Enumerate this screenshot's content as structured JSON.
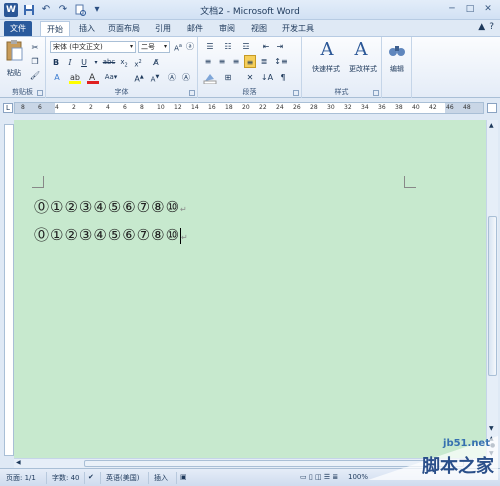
{
  "titlebar": {
    "logo": "W",
    "title": "文档2 - Microsoft Word",
    "qat": [
      "save-icon",
      "undo-icon",
      "redo-icon",
      "print-preview-icon",
      "customize-icon"
    ],
    "window_buttons": [
      "─",
      "□",
      "✕"
    ]
  },
  "tabs": {
    "file": "文件",
    "items": [
      "开始",
      "插入",
      "页面布局",
      "引用",
      "邮件",
      "审阅",
      "视图",
      "开发工具"
    ],
    "active": "开始",
    "right_icons": [
      "▲",
      "?"
    ]
  },
  "ribbon": {
    "clipboard": {
      "paste": "粘贴",
      "label": "剪贴板"
    },
    "font": {
      "name": "宋体 (中文正文)",
      "size": "二号",
      "label": "字体"
    },
    "paragraph": {
      "label": "段落"
    },
    "styles": {
      "quick": "快速样式",
      "change": "更改样式",
      "label": "样式"
    },
    "editing": {
      "label": "编辑"
    }
  },
  "document": {
    "line1": "⓪①②③④⑤⑥⑦⑧⑩",
    "line2": "⓪①②③④⑤⑥⑦⑧⑩",
    "para_mark": "↵"
  },
  "ruler": {
    "numbers": [
      "8",
      "6",
      "4",
      "2",
      "2",
      "4",
      "6",
      "8",
      "10",
      "12",
      "14",
      "16",
      "18",
      "20",
      "22",
      "24",
      "26",
      "28",
      "30",
      "32",
      "34",
      "36",
      "38",
      "40",
      "42",
      "46",
      "48"
    ]
  },
  "status": {
    "page": "页面: 1/1",
    "words": "字数: 40",
    "lang": "英语(美国)",
    "mode": "插入",
    "zoom": "100%"
  },
  "watermark": {
    "url": "jb51.net",
    "cn": "脚本之家"
  },
  "colors": {
    "doc_background": "#c7e9ce",
    "file_tab": "#2a5a9c"
  }
}
